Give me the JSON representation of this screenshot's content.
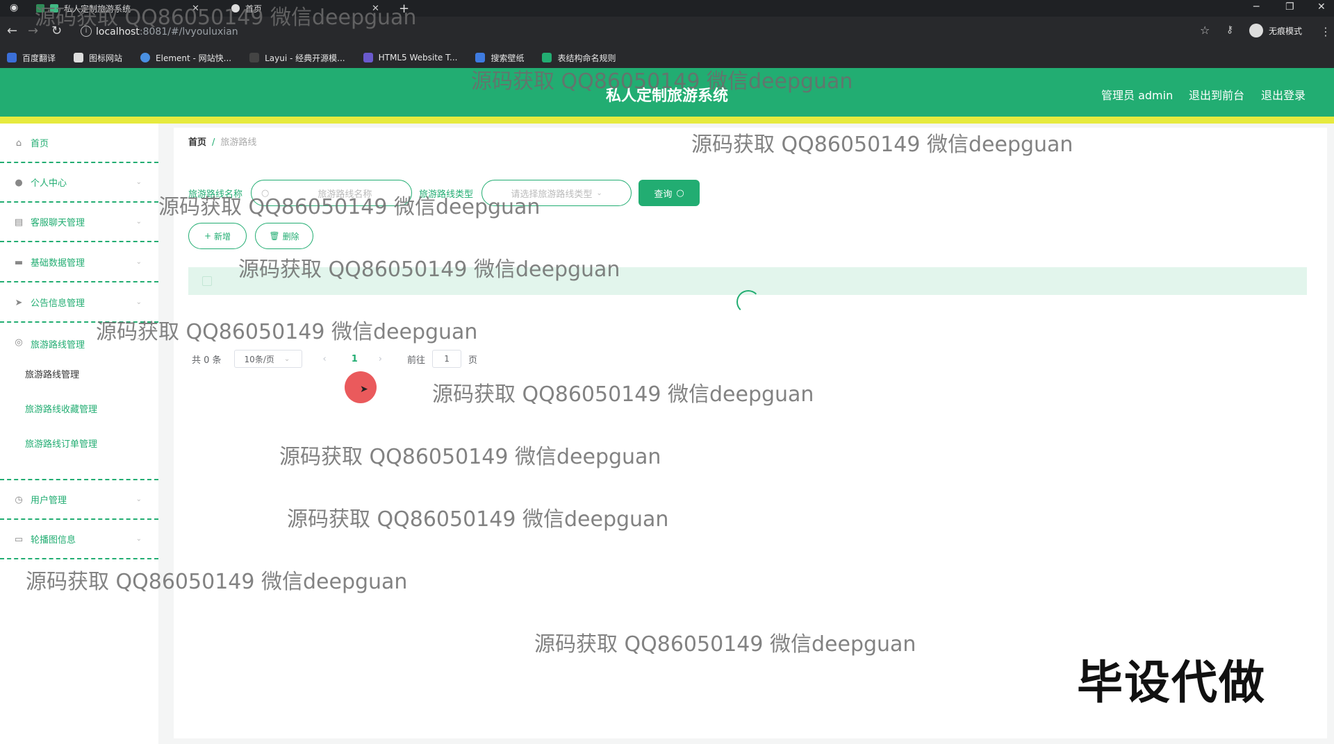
{
  "browser": {
    "tabs": [
      {
        "title": "私人定制旅游系统"
      },
      {
        "title": "首页"
      }
    ],
    "url_host": "localhost",
    "url_path": ":8081/#/lvyouluxian",
    "profile_label": "无痕模式",
    "bookmarks": [
      "百度翻译",
      "图标网站",
      "Element - 网站快...",
      "Layui - 经典开源模...",
      "HTML5 Website T...",
      "搜索壁纸",
      "表结构命名规则"
    ]
  },
  "header": {
    "title": "私人定制旅游系统",
    "admin_label": "管理员 admin",
    "front_link": "退出到前台",
    "logout_link": "退出登录"
  },
  "sidebar": {
    "items": [
      {
        "label": "首页",
        "icon": "home-icon"
      },
      {
        "label": "个人中心",
        "icon": "user-icon"
      },
      {
        "label": "客服聊天管理",
        "icon": "chat-icon"
      },
      {
        "label": "基础数据管理",
        "icon": "database-icon"
      },
      {
        "label": "公告信息管理",
        "icon": "send-icon"
      },
      {
        "label": "旅游路线管理",
        "icon": "route-icon"
      },
      {
        "label": "用户管理",
        "icon": "clock-icon"
      },
      {
        "label": "轮播图信息",
        "icon": "message-icon"
      }
    ],
    "sub_items": [
      "旅游路线管理",
      "旅游路线收藏管理",
      "旅游路线订单管理"
    ]
  },
  "breadcrumb": {
    "home": "首页",
    "current": "旅游路线"
  },
  "search": {
    "name_label": "旅游路线名称",
    "name_placeholder": "旅游路线名称",
    "type_label": "旅游路线类型",
    "type_placeholder": "请选择旅游路线类型",
    "query_button": "查询"
  },
  "actions": {
    "add": "新增",
    "delete": "删除"
  },
  "table": {
    "headers": [
      "",
      "",
      "",
      "",
      "",
      "",
      "",
      "",
      "",
      "",
      "",
      ""
    ],
    "loading_text": ""
  },
  "pagination": {
    "total": "共 0 条",
    "page_size": "10条/页",
    "current_page": "1",
    "goto_label": "前往",
    "goto_value": "1",
    "page_suffix": "页"
  },
  "watermark": "源码获取 QQ86050149 微信deepguan",
  "stamp": "毕设代做",
  "colors": {
    "primary": "#22ad72",
    "accent_strip": "#e6ea3e"
  }
}
